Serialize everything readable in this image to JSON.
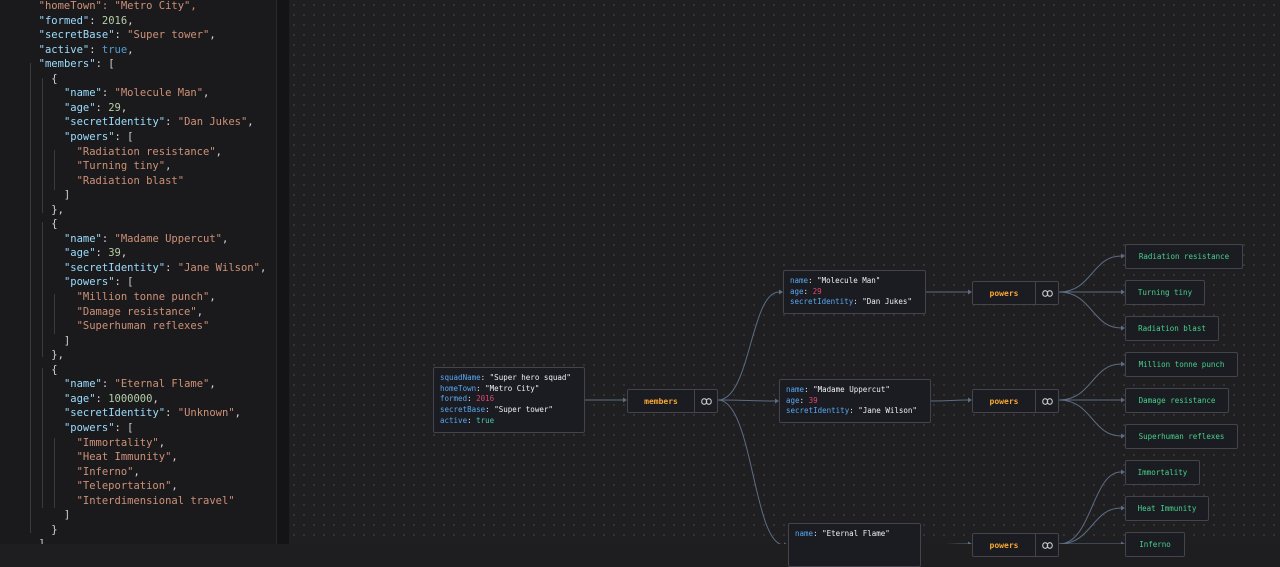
{
  "editor": {
    "lines": [
      [
        {
          "t": "  \"homeTown\": \"Metro City\",",
          "c": "s"
        }
      ],
      [
        {
          "t": "  ",
          "c": "p"
        },
        {
          "t": "\"formed\"",
          "c": "k"
        },
        {
          "t": ": ",
          "c": "p"
        },
        {
          "t": "2016",
          "c": "n"
        },
        {
          "t": ",",
          "c": "p"
        }
      ],
      [
        {
          "t": "  ",
          "c": "p"
        },
        {
          "t": "\"secretBase\"",
          "c": "k"
        },
        {
          "t": ": ",
          "c": "p"
        },
        {
          "t": "\"Super tower\"",
          "c": "s"
        },
        {
          "t": ",",
          "c": "p"
        }
      ],
      [
        {
          "t": "  ",
          "c": "p"
        },
        {
          "t": "\"active\"",
          "c": "k"
        },
        {
          "t": ": ",
          "c": "p"
        },
        {
          "t": "true",
          "c": "b"
        },
        {
          "t": ",",
          "c": "p"
        }
      ],
      [
        {
          "t": "  ",
          "c": "p"
        },
        {
          "t": "\"members\"",
          "c": "k"
        },
        {
          "t": ": [",
          "c": "p"
        }
      ],
      [
        {
          "t": "    {",
          "c": "p"
        }
      ],
      [
        {
          "t": "      ",
          "c": "p"
        },
        {
          "t": "\"name\"",
          "c": "k"
        },
        {
          "t": ": ",
          "c": "p"
        },
        {
          "t": "\"Molecule Man\"",
          "c": "s"
        },
        {
          "t": ",",
          "c": "p"
        }
      ],
      [
        {
          "t": "      ",
          "c": "p"
        },
        {
          "t": "\"age\"",
          "c": "k"
        },
        {
          "t": ": ",
          "c": "p"
        },
        {
          "t": "29",
          "c": "n"
        },
        {
          "t": ",",
          "c": "p"
        }
      ],
      [
        {
          "t": "      ",
          "c": "p"
        },
        {
          "t": "\"secretIdentity\"",
          "c": "k"
        },
        {
          "t": ": ",
          "c": "p"
        },
        {
          "t": "\"Dan Jukes\"",
          "c": "s"
        },
        {
          "t": ",",
          "c": "p"
        }
      ],
      [
        {
          "t": "      ",
          "c": "p"
        },
        {
          "t": "\"powers\"",
          "c": "k"
        },
        {
          "t": ": [",
          "c": "p"
        }
      ],
      [
        {
          "t": "        ",
          "c": "p"
        },
        {
          "t": "\"Radiation resistance\"",
          "c": "s"
        },
        {
          "t": ",",
          "c": "p"
        }
      ],
      [
        {
          "t": "        ",
          "c": "p"
        },
        {
          "t": "\"Turning tiny\"",
          "c": "s"
        },
        {
          "t": ",",
          "c": "p"
        }
      ],
      [
        {
          "t": "        ",
          "c": "p"
        },
        {
          "t": "\"Radiation blast\"",
          "c": "s"
        }
      ],
      [
        {
          "t": "      ]",
          "c": "p"
        }
      ],
      [
        {
          "t": "    },",
          "c": "p"
        }
      ],
      [
        {
          "t": "    {",
          "c": "p"
        }
      ],
      [
        {
          "t": "      ",
          "c": "p"
        },
        {
          "t": "\"name\"",
          "c": "k"
        },
        {
          "t": ": ",
          "c": "p"
        },
        {
          "t": "\"Madame Uppercut\"",
          "c": "s"
        },
        {
          "t": ",",
          "c": "p"
        }
      ],
      [
        {
          "t": "      ",
          "c": "p"
        },
        {
          "t": "\"age\"",
          "c": "k"
        },
        {
          "t": ": ",
          "c": "p"
        },
        {
          "t": "39",
          "c": "n"
        },
        {
          "t": ",",
          "c": "p"
        }
      ],
      [
        {
          "t": "      ",
          "c": "p"
        },
        {
          "t": "\"secretIdentity\"",
          "c": "k"
        },
        {
          "t": ": ",
          "c": "p"
        },
        {
          "t": "\"Jane Wilson\"",
          "c": "s"
        },
        {
          "t": ",",
          "c": "p"
        }
      ],
      [
        {
          "t": "      ",
          "c": "p"
        },
        {
          "t": "\"powers\"",
          "c": "k"
        },
        {
          "t": ": [",
          "c": "p"
        }
      ],
      [
        {
          "t": "        ",
          "c": "p"
        },
        {
          "t": "\"Million tonne punch\"",
          "c": "s"
        },
        {
          "t": ",",
          "c": "p"
        }
      ],
      [
        {
          "t": "        ",
          "c": "p"
        },
        {
          "t": "\"Damage resistance\"",
          "c": "s"
        },
        {
          "t": ",",
          "c": "p"
        }
      ],
      [
        {
          "t": "        ",
          "c": "p"
        },
        {
          "t": "\"Superhuman reflexes\"",
          "c": "s"
        }
      ],
      [
        {
          "t": "      ]",
          "c": "p"
        }
      ],
      [
        {
          "t": "    },",
          "c": "p"
        }
      ],
      [
        {
          "t": "    {",
          "c": "p"
        }
      ],
      [
        {
          "t": "      ",
          "c": "p"
        },
        {
          "t": "\"name\"",
          "c": "k"
        },
        {
          "t": ": ",
          "c": "p"
        },
        {
          "t": "\"Eternal Flame\"",
          "c": "s"
        },
        {
          "t": ",",
          "c": "p"
        }
      ],
      [
        {
          "t": "      ",
          "c": "p"
        },
        {
          "t": "\"age\"",
          "c": "k"
        },
        {
          "t": ": ",
          "c": "p"
        },
        {
          "t": "1000000",
          "c": "n"
        },
        {
          "t": ",",
          "c": "p"
        }
      ],
      [
        {
          "t": "      ",
          "c": "p"
        },
        {
          "t": "\"secretIdentity\"",
          "c": "k"
        },
        {
          "t": ": ",
          "c": "p"
        },
        {
          "t": "\"Unknown\"",
          "c": "s"
        },
        {
          "t": ",",
          "c": "p"
        }
      ],
      [
        {
          "t": "      ",
          "c": "p"
        },
        {
          "t": "\"powers\"",
          "c": "k"
        },
        {
          "t": ": [",
          "c": "p"
        }
      ],
      [
        {
          "t": "        ",
          "c": "p"
        },
        {
          "t": "\"Immortality\"",
          "c": "s"
        },
        {
          "t": ",",
          "c": "p"
        }
      ],
      [
        {
          "t": "        ",
          "c": "p"
        },
        {
          "t": "\"Heat Immunity\"",
          "c": "s"
        },
        {
          "t": ",",
          "c": "p"
        }
      ],
      [
        {
          "t": "        ",
          "c": "p"
        },
        {
          "t": "\"Inferno\"",
          "c": "s"
        },
        {
          "t": ",",
          "c": "p"
        }
      ],
      [
        {
          "t": "        ",
          "c": "p"
        },
        {
          "t": "\"Teleportation\"",
          "c": "s"
        },
        {
          "t": ",",
          "c": "p"
        }
      ],
      [
        {
          "t": "        ",
          "c": "p"
        },
        {
          "t": "\"Interdimensional travel\"",
          "c": "s"
        }
      ],
      [
        {
          "t": "      ]",
          "c": "p"
        }
      ],
      [
        {
          "t": "    }",
          "c": "p"
        }
      ],
      [
        {
          "t": "  ]",
          "c": "p"
        }
      ]
    ]
  },
  "graph": {
    "root": {
      "rows": [
        {
          "key": "squadName",
          "val": "\"Super hero squad\"",
          "type": "str"
        },
        {
          "key": "homeTown",
          "val": "\"Metro City\"",
          "type": "str"
        },
        {
          "key": "formed",
          "val": "2016",
          "type": "num"
        },
        {
          "key": "secretBase",
          "val": "\"Super tower\"",
          "type": "str"
        },
        {
          "key": "active",
          "val": "true",
          "type": "bool"
        }
      ]
    },
    "members_label": "members",
    "powers_label": "powers",
    "link_icon": "link-icon",
    "members": [
      {
        "rows": [
          {
            "key": "name",
            "val": "\"Molecule Man\"",
            "type": "str"
          },
          {
            "key": "age",
            "val": "29",
            "type": "num"
          },
          {
            "key": "secretIdentity",
            "val": "\"Dan Jukes\"",
            "type": "str"
          }
        ],
        "powers": [
          "Radiation resistance",
          "Turning tiny",
          "Radiation blast"
        ]
      },
      {
        "rows": [
          {
            "key": "name",
            "val": "\"Madame Uppercut\"",
            "type": "str"
          },
          {
            "key": "age",
            "val": "39",
            "type": "num"
          },
          {
            "key": "secretIdentity",
            "val": "\"Jane Wilson\"",
            "type": "str"
          }
        ],
        "powers": [
          "Million tonne punch",
          "Damage resistance",
          "Superhuman reflexes"
        ]
      },
      {
        "rows": [
          {
            "key": "name",
            "val": "\"Eternal Flame\"",
            "type": "str"
          }
        ],
        "powers": [
          "Immortality",
          "Heat Immunity",
          "Inferno"
        ]
      }
    ]
  },
  "colors": {
    "key": "#59a7f0",
    "number": "#e0466e",
    "bool": "#4ec9b0",
    "array_label": "#f7a733",
    "leaf": "#46d18a"
  }
}
